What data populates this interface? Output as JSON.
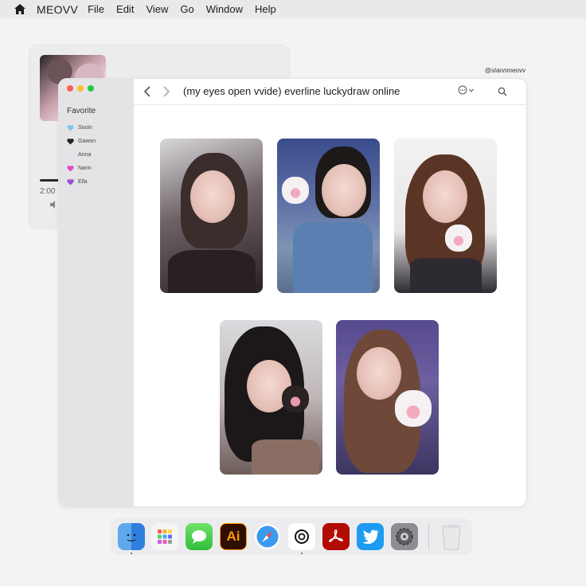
{
  "menubar": {
    "app_name": "MEOVV",
    "items": [
      "File",
      "Edit",
      "View",
      "Go",
      "Window",
      "Help"
    ]
  },
  "player": {
    "time": "2:00",
    "progress": 0.2
  },
  "handle": "@stannmeovv",
  "finder": {
    "title": "(my eyes open vvide) everline luckydraw online",
    "sidebar": {
      "section": "Favorite",
      "items": [
        {
          "label": "Sooin",
          "heart_color": "#7ec8f0"
        },
        {
          "label": "Gawon",
          "heart_color": "#222222"
        },
        {
          "label": "Anna",
          "heart_color": "#dfe6ee"
        },
        {
          "label": "Narin",
          "heart_color": "#e04fc0"
        },
        {
          "label": "Ella",
          "heart_color": "#9a4fd6"
        }
      ]
    },
    "photos": [
      "photocard-1",
      "photocard-2",
      "photocard-3",
      "photocard-4",
      "photocard-5"
    ]
  },
  "dock": {
    "apps": [
      "Finder",
      "Launchpad",
      "Messages",
      "Illustrator",
      "Safari",
      "Threads",
      "Acrobat",
      "Twitter",
      "System Settings",
      "Trash"
    ],
    "illustrator_label": "Ai"
  },
  "colors": {
    "close": "#fe5f57",
    "minimize": "#febc2e",
    "zoom": "#28c840"
  }
}
